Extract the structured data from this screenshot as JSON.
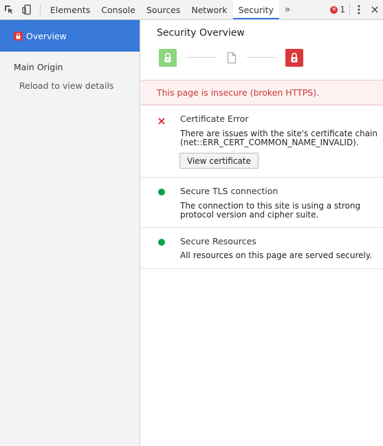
{
  "toolbar": {
    "tabs": [
      {
        "label": "Elements"
      },
      {
        "label": "Console"
      },
      {
        "label": "Sources"
      },
      {
        "label": "Network"
      },
      {
        "label": "Security",
        "active": true
      }
    ],
    "more_label": "»",
    "error_count": "1",
    "icons": [
      "inspect-element-icon",
      "device-toolbar-icon",
      "error-icon",
      "kebab-menu-icon",
      "close-icon"
    ]
  },
  "sidebar": {
    "overview_label": "Overview",
    "main_origin_label": "Main Origin",
    "reload_label": "Reload to view details"
  },
  "main": {
    "title": "Security Overview",
    "banner_text": "This page is insecure (broken HTTPS).",
    "sections": [
      {
        "title": "Certificate Error",
        "description": "There are issues with the site's certificate chain (net::ERR_CERT_COMMON_NAME_INVALID).",
        "button_label": "View certificate",
        "status": "error"
      },
      {
        "title": "Secure TLS connection",
        "description": "The connection to this site is using a strong protocol version and cipher suite.",
        "status": "secure"
      },
      {
        "title": "Secure Resources",
        "description": "All resources on this page are served securely.",
        "status": "secure"
      }
    ]
  },
  "colors": {
    "accent": "#3879d9",
    "error": "#d9373b",
    "secure_green": "#0ca14a",
    "lock_green": "#8cd67f",
    "banner_bg": "#fdf1f1",
    "banner_text": "#cc3636"
  }
}
